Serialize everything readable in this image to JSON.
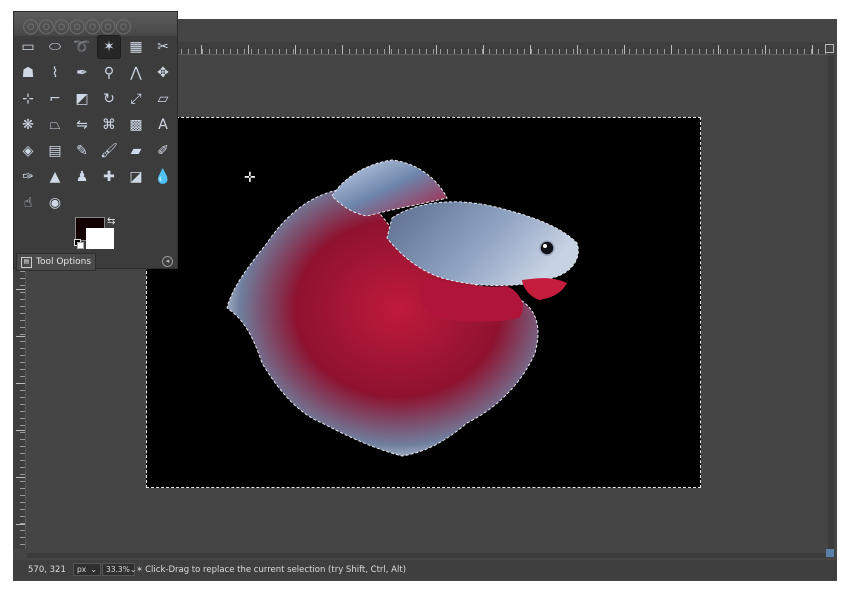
{
  "toolbox": {
    "tools": [
      {
        "name": "rect-select-icon",
        "glyph": "▭",
        "active": false
      },
      {
        "name": "ellipse-select-icon",
        "glyph": "⬭",
        "active": false
      },
      {
        "name": "free-select-icon",
        "glyph": "➰",
        "active": false
      },
      {
        "name": "fuzzy-select-icon",
        "glyph": "✶",
        "active": true
      },
      {
        "name": "select-by-color-icon",
        "glyph": "▦",
        "active": false
      },
      {
        "name": "scissors-select-icon",
        "glyph": "✂",
        "active": false
      },
      {
        "name": "foreground-select-icon",
        "glyph": "☗",
        "active": false
      },
      {
        "name": "paths-icon",
        "glyph": "⌇",
        "active": false
      },
      {
        "name": "color-picker-icon",
        "glyph": "✒",
        "active": false
      },
      {
        "name": "zoom-icon",
        "glyph": "⚲",
        "active": false
      },
      {
        "name": "measure-icon",
        "glyph": "⋀",
        "active": false
      },
      {
        "name": "move-icon",
        "glyph": "✥",
        "active": false
      },
      {
        "name": "align-icon",
        "glyph": "⊹",
        "active": false
      },
      {
        "name": "crop-icon",
        "glyph": "⌐",
        "active": false
      },
      {
        "name": "unified-transform-icon",
        "glyph": "◩",
        "active": false
      },
      {
        "name": "rotate-icon",
        "glyph": "↻",
        "active": false
      },
      {
        "name": "scale-icon",
        "glyph": "⤢",
        "active": false
      },
      {
        "name": "shear-icon",
        "glyph": "▱",
        "active": false
      },
      {
        "name": "warp-transform-icon",
        "glyph": "❋",
        "active": false
      },
      {
        "name": "perspective-icon",
        "glyph": "⏢",
        "active": false
      },
      {
        "name": "flip-icon",
        "glyph": "⇋",
        "active": false
      },
      {
        "name": "cage-transform-icon",
        "glyph": "⌘",
        "active": false
      },
      {
        "name": "checkerboard-icon",
        "glyph": "▩",
        "active": false
      },
      {
        "name": "text-icon",
        "glyph": "A",
        "active": false
      },
      {
        "name": "bucket-fill-icon",
        "glyph": "◈",
        "active": false
      },
      {
        "name": "gradient-icon",
        "glyph": "▤",
        "active": false
      },
      {
        "name": "pencil-icon",
        "glyph": "✎",
        "active": false
      },
      {
        "name": "paintbrush-icon",
        "glyph": "🖌",
        "active": false
      },
      {
        "name": "eraser-icon",
        "glyph": "▰",
        "active": false
      },
      {
        "name": "airbrush-icon",
        "glyph": "✐",
        "active": false
      },
      {
        "name": "ink-icon",
        "glyph": "✑",
        "active": false
      },
      {
        "name": "mypaint-brush-icon",
        "glyph": "▲",
        "active": false
      },
      {
        "name": "clone-icon",
        "glyph": "♟",
        "active": false
      },
      {
        "name": "heal-icon",
        "glyph": "✚",
        "active": false
      },
      {
        "name": "perspective-clone-icon",
        "glyph": "◪",
        "active": false
      },
      {
        "name": "blur-sharpen-icon",
        "glyph": "💧",
        "active": false
      },
      {
        "name": "smudge-icon",
        "glyph": "☝",
        "active": false
      },
      {
        "name": "dodge-burn-icon",
        "glyph": "◉",
        "active": false
      }
    ],
    "tool_options_label": "Tool Options",
    "foreground_color": "#120000",
    "background_color": "#ffffff"
  },
  "statusbar": {
    "coords": "570, 321",
    "unit": "px",
    "zoom": "33.3%",
    "message": "Click-Drag to replace the current selection (try Shift, Ctrl, Alt)"
  },
  "colors": {
    "canvas_background": "#454545",
    "image_background": "#000000",
    "fish_red": "#b3143a",
    "fish_blue": "#7f93b4"
  }
}
